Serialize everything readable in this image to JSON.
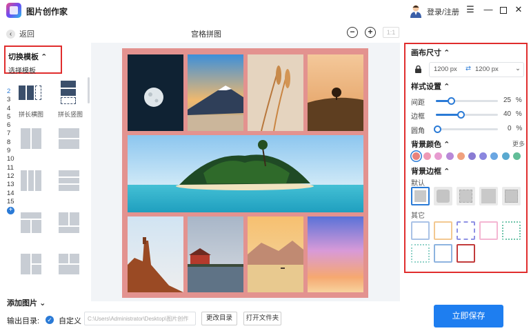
{
  "app": {
    "title": "图片创作家",
    "login": "登录/注册"
  },
  "toolbar": {
    "back": "返回",
    "canvas_title": "宫格拼图",
    "zoom_out": "−",
    "zoom_in": "+",
    "ratio": "1:1"
  },
  "left": {
    "switch_template": "切换模板",
    "choose_template": "选择模板",
    "page_numbers": [
      "2",
      "3",
      "4",
      "5",
      "6",
      "7",
      "8",
      "9",
      "10",
      "11",
      "12",
      "13",
      "14",
      "15"
    ],
    "active_number": "2",
    "templates": [
      {
        "label": "拼长横图"
      },
      {
        "label": "拼长竖图"
      }
    ]
  },
  "right": {
    "canvas_size": "画布尺寸",
    "width": "1200 px",
    "height": "1200 px",
    "style_settings": "样式设置",
    "sliders": [
      {
        "label": "间距",
        "value": "25",
        "unit": "%",
        "level": 0.25
      },
      {
        "label": "边框",
        "value": "40",
        "unit": "%",
        "level": 0.4
      },
      {
        "label": "圆角",
        "value": "0",
        "unit": "%",
        "level": 0.0
      }
    ],
    "bg_color": "背景颜色",
    "more": "更多",
    "swatches": [
      "#e8827c",
      "#ee9ab5",
      "#e79bd0",
      "#b889d8",
      "#f0a17e",
      "#8a7bd3",
      "#8b87df",
      "#6aa6e2",
      "#5aa9d0",
      "#62bd98"
    ],
    "bg_border": "背景边框",
    "default": "默认",
    "other": "其它"
  },
  "bottom": {
    "add_photo": "添加图片",
    "output_dir": "输出目录:",
    "custom": "自定义",
    "path": "C:\\Users\\Administrator\\Desktop\\图片创作",
    "change_dir": "更改目录",
    "open_folder": "打开文件夹",
    "save": "立即保存"
  },
  "colors": {
    "accent": "#1e7ef0",
    "board": "#e3928f",
    "highlight": "#e02c2c"
  }
}
